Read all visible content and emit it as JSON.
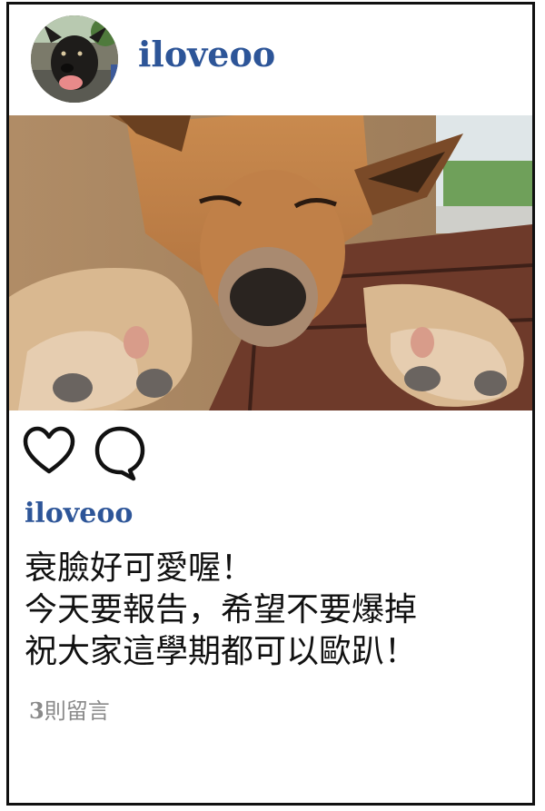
{
  "post": {
    "author": "iloveoo",
    "caption_author": "iloveoo",
    "caption_lines": [
      "衰臉好可愛喔！",
      "今天要報告，希望不要爆掉",
      "祝大家這學期都可以歐趴！"
    ],
    "comment_count": "3",
    "comment_label": "則留言"
  },
  "icons": {
    "like": "heart-outline-icon",
    "comment": "speech-bubble-icon"
  },
  "colors": {
    "username": "#2d5598",
    "caption_text": "#111111",
    "meta_text": "#8a8a8a",
    "border": "#111111"
  }
}
